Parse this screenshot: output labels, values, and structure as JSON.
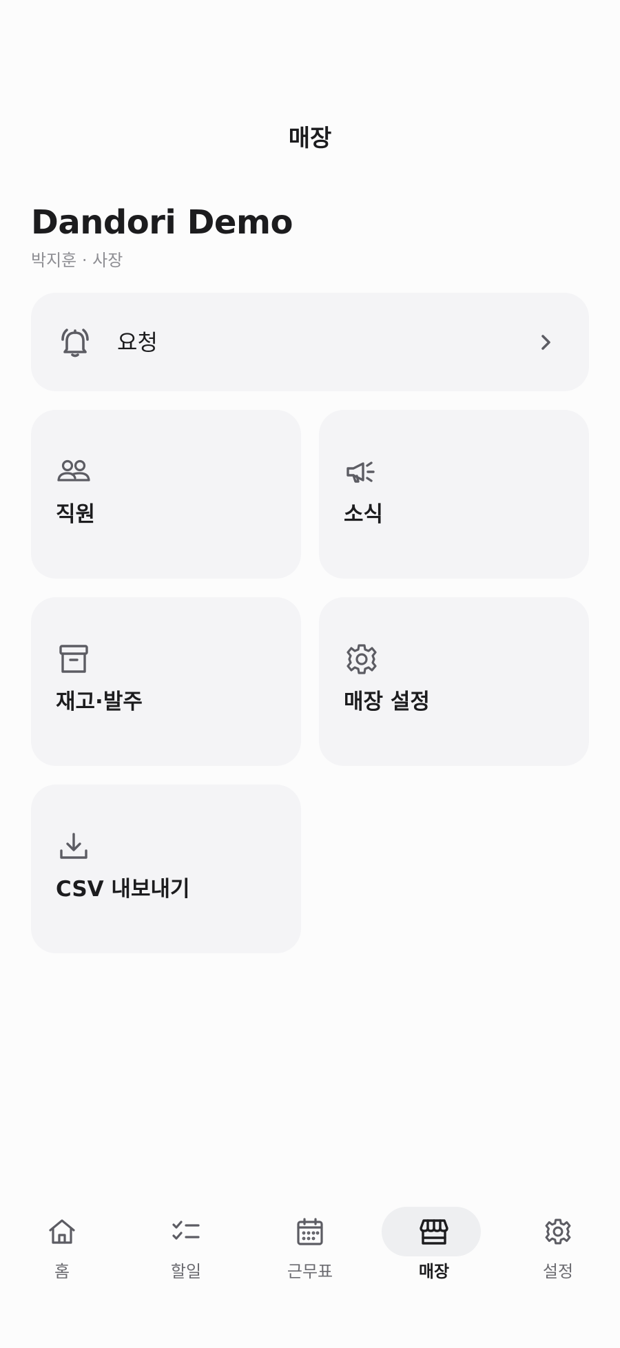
{
  "header": {
    "title": "매장"
  },
  "store": {
    "name": "Dandori Demo",
    "subtitle": "박지훈 · 사장"
  },
  "requests": {
    "label": "요청",
    "icon": "bell-icon",
    "chevron": "chevron-right-icon"
  },
  "tiles": [
    {
      "label": "직원",
      "icon": "people-icon"
    },
    {
      "label": "소식",
      "icon": "megaphone-icon"
    },
    {
      "label": "재고·발주",
      "icon": "archive-box-icon"
    },
    {
      "label": "매장 설정",
      "icon": "gear-icon"
    },
    {
      "label": "CSV 내보내기",
      "icon": "download-icon"
    }
  ],
  "tabbar": {
    "active": "매장",
    "items": [
      {
        "label": "홈",
        "icon": "home-icon"
      },
      {
        "label": "할일",
        "icon": "checklist-icon"
      },
      {
        "label": "근무표",
        "icon": "calendar-icon"
      },
      {
        "label": "매장",
        "icon": "storefront-icon"
      },
      {
        "label": "설정",
        "icon": "gear-icon"
      }
    ]
  },
  "colors": {
    "background": "#fcfcfc",
    "card": "#f4f4f6",
    "text": "#1c1c1e",
    "secondary_text": "#8e8e93",
    "icon": "#5c5c63",
    "active_pill": "#eeeff1"
  }
}
